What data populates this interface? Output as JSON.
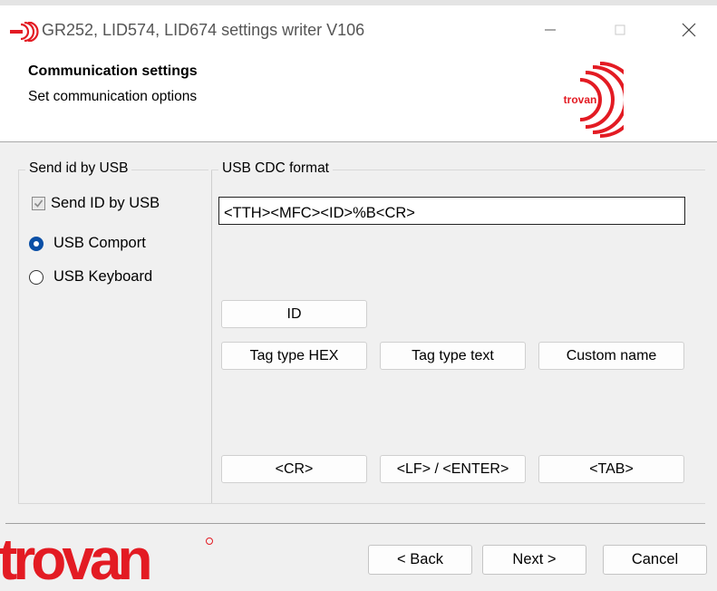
{
  "window": {
    "title": "GR252, LID574, LID674 settings writer V106",
    "app_icon": "trovan-logo-icon",
    "controls": [
      "minimize-icon",
      "maximize-icon",
      "close-icon"
    ]
  },
  "header": {
    "title": "Communication settings",
    "subtitle": "Set communication options",
    "logo_text": "trovan"
  },
  "send_group": {
    "label": "Send id by USB",
    "checkbox_label": "Send ID by USB",
    "checkbox_checked": true,
    "checkbox_enabled": false,
    "radios": [
      {
        "label": "USB Comport",
        "selected": true
      },
      {
        "label": "USB Keyboard",
        "selected": false
      }
    ]
  },
  "format_group": {
    "label": "USB CDC format",
    "format_value": "<TTH><MFC><ID>%B<CR>",
    "buttons_row1": [
      "ID"
    ],
    "buttons_row2": [
      "Tag type HEX",
      "Tag type text",
      "Custom name"
    ],
    "buttons_row3": [
      "<CR>",
      "<LF> / <ENTER>",
      "<TAB>"
    ]
  },
  "footer": {
    "brand_text": "trovan",
    "back_label": "< Back",
    "next_label": "Next >",
    "cancel_label": "Cancel"
  },
  "colors": {
    "brand_red": "#e31b23",
    "radio_blue": "#0a4fa6"
  }
}
